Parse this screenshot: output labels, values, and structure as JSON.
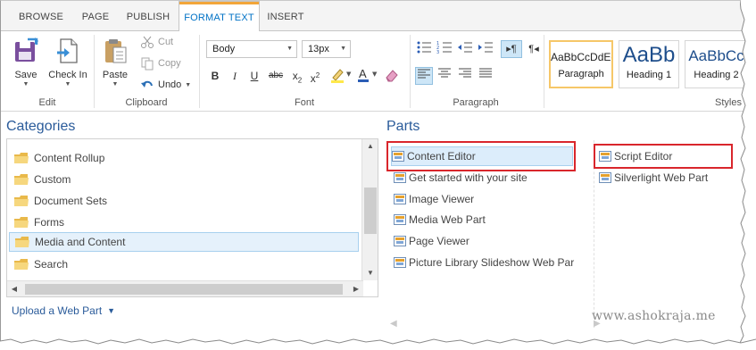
{
  "ribbon": {
    "tabs": [
      {
        "label": "BROWSE",
        "active": false
      },
      {
        "label": "PAGE",
        "active": false
      },
      {
        "label": "PUBLISH",
        "active": false
      },
      {
        "label": "FORMAT TEXT",
        "active": true
      },
      {
        "label": "INSERT",
        "active": false
      }
    ],
    "edit": {
      "save_label": "Save",
      "checkin_label": "Check In",
      "group_label": "Edit"
    },
    "clipboard": {
      "paste_label": "Paste",
      "cut_label": "Cut",
      "copy_label": "Copy",
      "undo_label": "Undo",
      "group_label": "Clipboard"
    },
    "font": {
      "font_value": "Body",
      "size_value": "13px",
      "group_label": "Font",
      "bold": "B",
      "italic": "I",
      "underline": "U",
      "strike": "abc",
      "subscript": "x",
      "subscript_sub": "2",
      "superscript": "x",
      "superscript_sup": "2"
    },
    "paragraph": {
      "group_label": "Paragraph",
      "ltr": "¶",
      "rtl": "¶"
    },
    "styles": {
      "group_label": "Styles",
      "items": [
        {
          "sample": "AaBbCcDdEe",
          "name": "Paragraph",
          "selected": true
        },
        {
          "sample": "AaBb",
          "name": "Heading 1",
          "selected": false
        },
        {
          "sample": "AaBbCc",
          "name": "Heading 2",
          "selected": false
        }
      ]
    }
  },
  "categories": {
    "title": "Categories",
    "items": [
      {
        "label": "Content Rollup",
        "selected": false
      },
      {
        "label": "Custom",
        "selected": false
      },
      {
        "label": "Document Sets",
        "selected": false
      },
      {
        "label": "Forms",
        "selected": false
      },
      {
        "label": "Media and Content",
        "selected": true
      },
      {
        "label": "Search",
        "selected": false
      }
    ],
    "upload_label": "Upload a Web Part"
  },
  "parts": {
    "title": "Parts",
    "column1": [
      {
        "label": "Content Editor",
        "selected": true
      },
      {
        "label": "Get started with your site",
        "selected": false
      },
      {
        "label": "Image Viewer",
        "selected": false
      },
      {
        "label": "Media Web Part",
        "selected": false
      },
      {
        "label": "Page Viewer",
        "selected": false
      },
      {
        "label": "Picture Library Slideshow Web Par",
        "selected": false
      }
    ],
    "column2": [
      {
        "label": "Script Editor",
        "selected": false
      },
      {
        "label": "Silverlight Web Part",
        "selected": false
      }
    ]
  },
  "watermark": "www.ashokraja.me",
  "colors": {
    "accent": "#0072c6",
    "title_blue": "#2a5b9a",
    "highlight_red": "#d9262c",
    "tab_orange": "#f2a63a"
  }
}
